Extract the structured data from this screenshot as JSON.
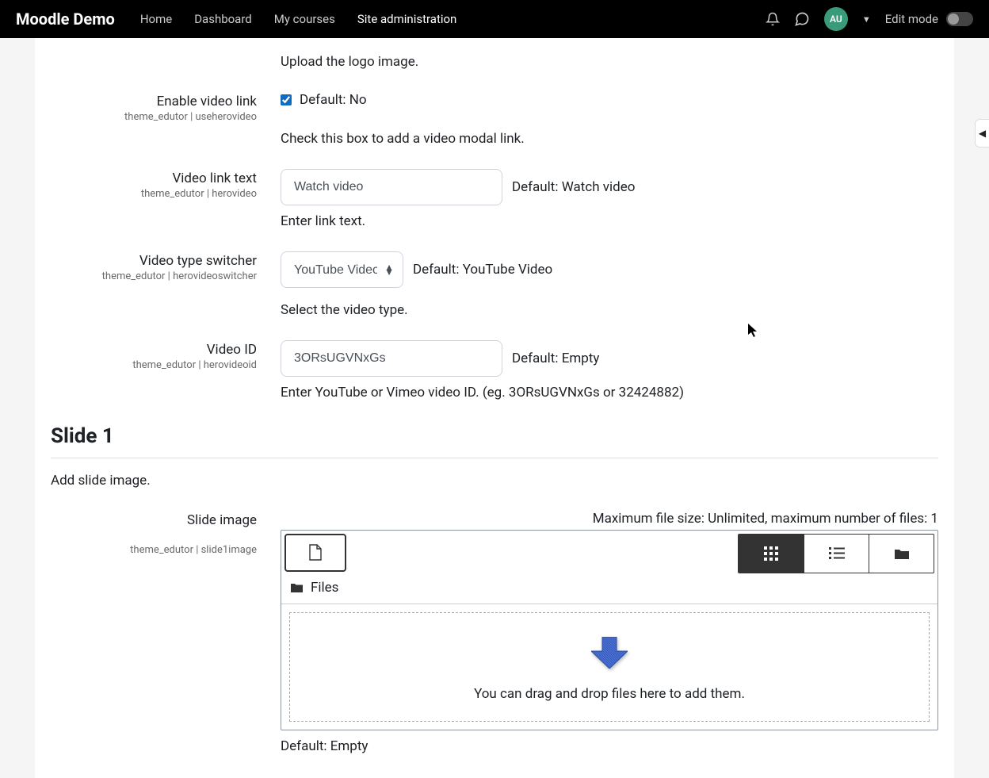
{
  "navbar": {
    "brand": "Moodle Demo",
    "links": [
      "Home",
      "Dashboard",
      "My courses",
      "Site administration"
    ],
    "active_index": 3,
    "avatar": "AU",
    "edit_mode": "Edit mode"
  },
  "upload_logo_desc": "Upload the logo image.",
  "enable_video": {
    "label": "Enable video link",
    "key": "theme_edutor | useherovideo",
    "checked": true,
    "default": "Default: No",
    "desc": "Check this box to add a video modal link."
  },
  "video_link_text": {
    "label": "Video link text",
    "key": "theme_edutor | herovideo",
    "value": "Watch video",
    "default": "Default: Watch video",
    "desc": "Enter link text."
  },
  "video_type": {
    "label": "Video type switcher",
    "key": "theme_edutor | herovideoswitcher",
    "value": "YouTube Video",
    "default": "Default: YouTube Video",
    "desc": "Select the video type."
  },
  "video_id": {
    "label": "Video ID",
    "key": "theme_edutor | herovideoid",
    "value": "3ORsUGVNxGs",
    "default": "Default: Empty",
    "desc": "Enter YouTube or Vimeo video ID. (eg. 3ORsUGVNxGs or 32424882)"
  },
  "slide1": {
    "heading": "Slide 1",
    "sub": "Add slide image.",
    "label": "Slide image",
    "key": "theme_edutor | slide1image",
    "file_info": "Maximum file size: Unlimited, maximum number of files: 1",
    "files_label": "Files",
    "drop_text": "You can drag and drop files here to add them.",
    "default": "Default: Empty"
  }
}
